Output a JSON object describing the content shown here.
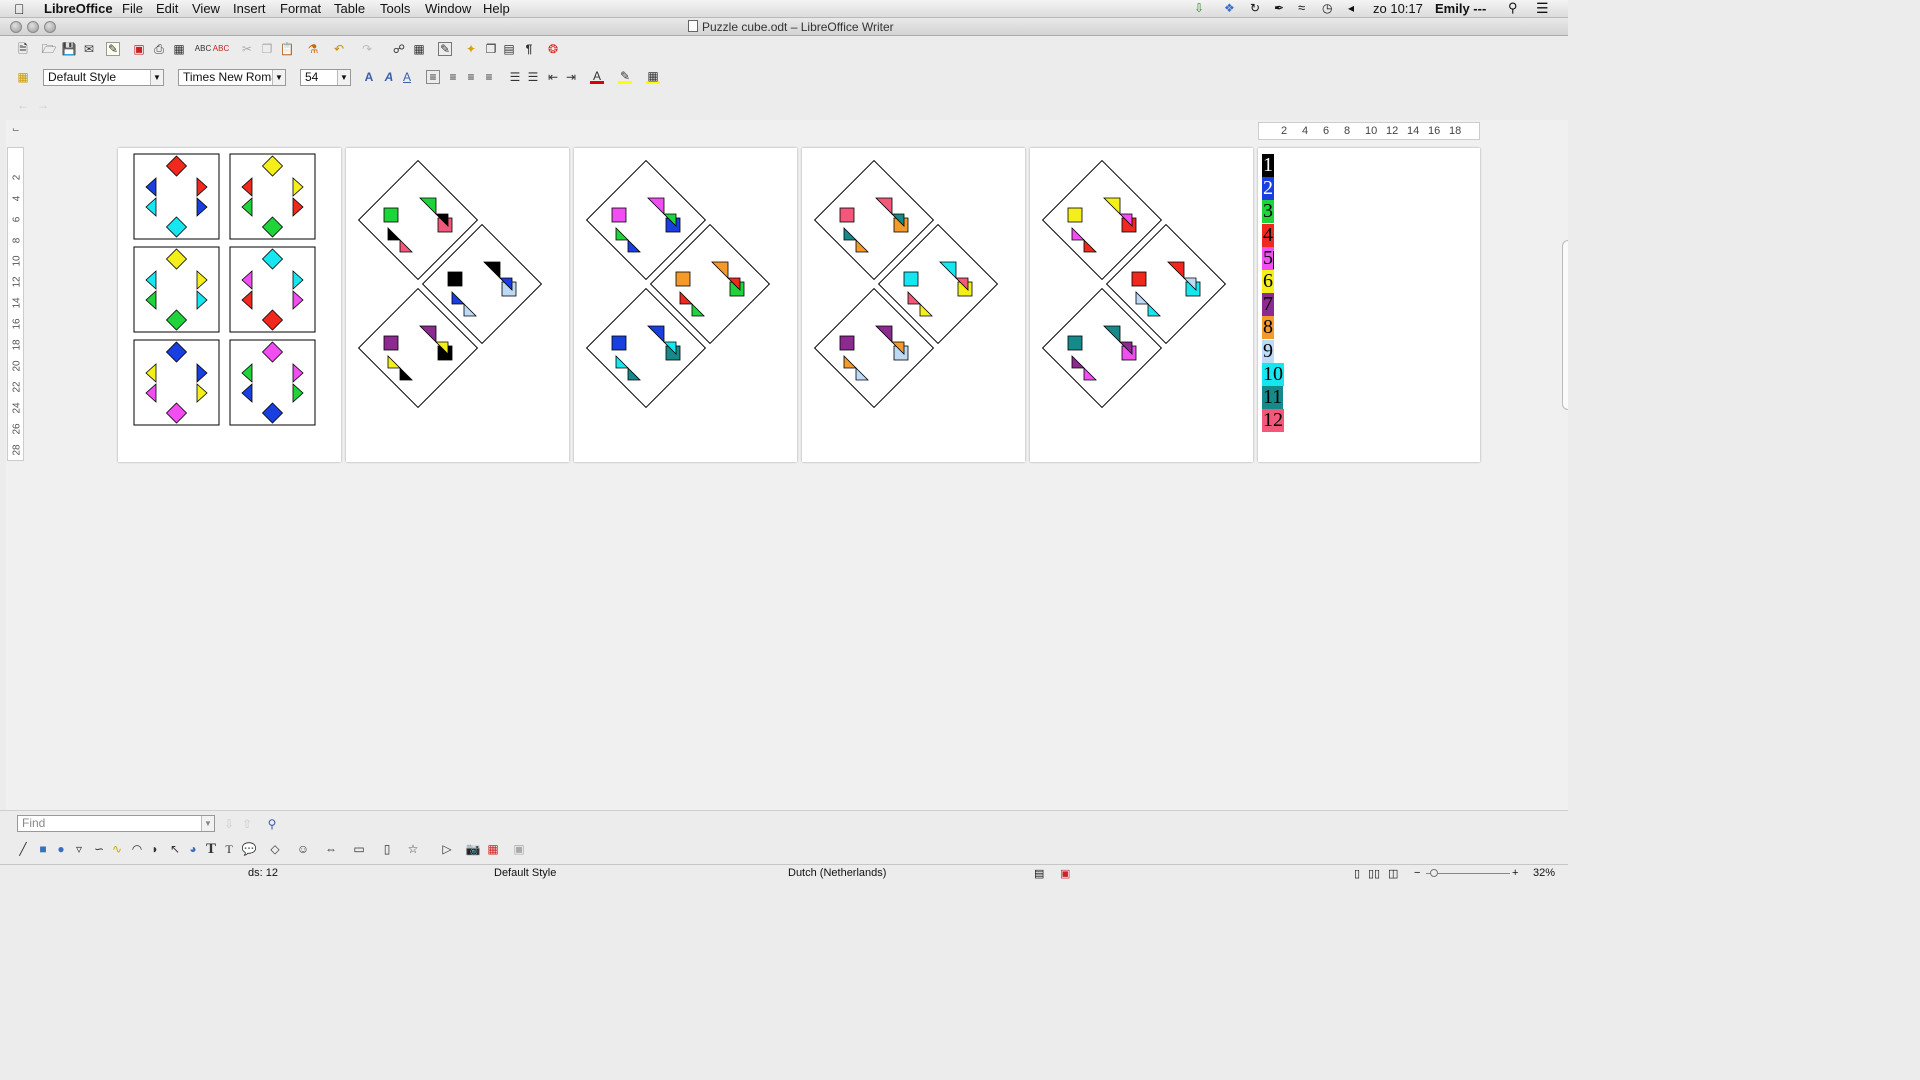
{
  "menubar": {
    "app": "LibreOffice",
    "items": [
      "File",
      "Edit",
      "View",
      "Insert",
      "Format",
      "Table",
      "Tools",
      "Window",
      "Help"
    ],
    "clock": "zo 10:17",
    "user": "Emily ---"
  },
  "titlebar": {
    "title": "Puzzle cube.odt – LibreOffice Writer"
  },
  "formatting": {
    "paragraph_style": "Default Style",
    "font_name": "Times New Roma",
    "font_size": "54"
  },
  "ruler": {
    "vertical": [
      "2",
      "4",
      "6",
      "8",
      "10",
      "12",
      "14",
      "16",
      "18",
      "20",
      "22",
      "24",
      "26",
      "28"
    ],
    "horizontal": [
      "2",
      "4",
      "6",
      "8",
      "10",
      "12",
      "14",
      "16",
      "18"
    ]
  },
  "color_list": [
    {
      "label": "1",
      "color": "#000000",
      "text": "#ffffff"
    },
    {
      "label": "2",
      "color": "#1a3fe0",
      "text": "#ffffff"
    },
    {
      "label": "3",
      "color": "#1fd43a",
      "text": "#000000"
    },
    {
      "label": "4",
      "color": "#f0281e",
      "text": "#000000"
    },
    {
      "label": "5",
      "color": "#f04ef0",
      "text": "#000000"
    },
    {
      "label": "6",
      "color": "#f4ef1a",
      "text": "#000000"
    },
    {
      "label": "7",
      "color": "#8b2a8f",
      "text": "#000000"
    },
    {
      "label": "8",
      "color": "#f39a2a",
      "text": "#000000"
    },
    {
      "label": "9",
      "color": "#bcd9f5",
      "text": "#000000"
    },
    {
      "label": "10",
      "color": "#16e6f0",
      "text": "#000000"
    },
    {
      "label": "11",
      "color": "#168a8a",
      "text": "#000000"
    },
    {
      "label": "12",
      "color": "#f2587a",
      "text": "#000000"
    }
  ],
  "cards": [
    {
      "top": "#f0281e",
      "left": "#1a3fe0",
      "right": "#f0281e",
      "bottom": "#16e6f0",
      "lefta": "#1a3fe0",
      "leftb": "#16e6f0",
      "righta": "#f0281e",
      "rightb": "#1a3fe0"
    },
    {
      "top": "#f4ef1a",
      "lefta": "#f0281e",
      "leftb": "#1fd43a",
      "righta": "#f4ef1a",
      "rightb": "#f0281e",
      "bottom": "#1fd43a"
    },
    {
      "top": "#f4ef1a",
      "lefta": "#16e6f0",
      "leftb": "#1fd43a",
      "righta": "#f4ef1a",
      "rightb": "#16e6f0",
      "bottom": "#1fd43a"
    },
    {
      "top": "#16e6f0",
      "lefta": "#f04ef0",
      "leftb": "#f0281e",
      "righta": "#16e6f0",
      "rightb": "#f04ef0",
      "bottom": "#f0281e"
    },
    {
      "top": "#1a3fe0",
      "lefta": "#f4ef1a",
      "leftb": "#f04ef0",
      "righta": "#1a3fe0",
      "rightb": "#f4ef1a",
      "bottom": "#f04ef0"
    },
    {
      "top": "#f04ef0",
      "lefta": "#1fd43a",
      "leftb": "#1a3fe0",
      "righta": "#f04ef0",
      "rightb": "#1fd43a",
      "bottom": "#1a3fe0"
    }
  ],
  "tiles": [
    [
      {
        "sq1": "#1fd43a",
        "t1a": "#1fd43a",
        "t1b": "#000000",
        "t2a": "#000000",
        "t2b": "#f2587a",
        "sq2": "#f2587a"
      },
      {
        "sq1": "#000000",
        "t1a": "#000000",
        "t1b": "#1a3fe0",
        "t2a": "#1a3fe0",
        "t2b": "#bcd9f5",
        "sq2": "#bcd9f5"
      },
      {
        "sq1": "#8b2a8f",
        "t1a": "#8b2a8f",
        "t1b": "#f4ef1a",
        "t2a": "#f4ef1a",
        "t2b": "#000000",
        "sq2": "#000000"
      }
    ],
    [
      {
        "sq1": "#f04ef0",
        "t1a": "#f04ef0",
        "t1b": "#1fd43a",
        "t2a": "#1fd43a",
        "t2b": "#1a3fe0",
        "sq2": "#1a3fe0"
      },
      {
        "sq1": "#f39a2a",
        "t1a": "#f39a2a",
        "t1b": "#f0281e",
        "t2a": "#f0281e",
        "t2b": "#1fd43a",
        "sq2": "#1fd43a"
      },
      {
        "sq1": "#1a3fe0",
        "t1a": "#1a3fe0",
        "t1b": "#16e6f0",
        "t2a": "#16e6f0",
        "t2b": "#168a8a",
        "sq2": "#168a8a"
      }
    ],
    [
      {
        "sq1": "#f2587a",
        "t1a": "#f2587a",
        "t1b": "#168a8a",
        "t2a": "#168a8a",
        "t2b": "#f39a2a",
        "sq2": "#f39a2a"
      },
      {
        "sq1": "#16e6f0",
        "t1a": "#16e6f0",
        "t1b": "#f2587a",
        "t2a": "#f2587a",
        "t2b": "#f4ef1a",
        "sq2": "#f4ef1a"
      },
      {
        "sq1": "#8b2a8f",
        "t1a": "#8b2a8f",
        "t1b": "#f39a2a",
        "t2a": "#f39a2a",
        "t2b": "#bcd9f5",
        "sq2": "#bcd9f5"
      }
    ],
    [
      {
        "sq1": "#f4ef1a",
        "t1a": "#f4ef1a",
        "t1b": "#f04ef0",
        "t2a": "#f04ef0",
        "t2b": "#f0281e",
        "sq2": "#f0281e"
      },
      {
        "sq1": "#f0281e",
        "t1a": "#f0281e",
        "t1b": "#bcd9f5",
        "t2a": "#bcd9f5",
        "t2b": "#16e6f0",
        "sq2": "#16e6f0"
      },
      {
        "sq1": "#168a8a",
        "t1a": "#168a8a",
        "t1b": "#8b2a8f",
        "t2a": "#8b2a8f",
        "t2b": "#f04ef0",
        "sq2": "#f04ef0"
      }
    ]
  ],
  "find": {
    "placeholder": "Find"
  },
  "statusbar": {
    "words": "ds: 12",
    "page_style": "Default Style",
    "language": "Dutch (Netherlands)",
    "zoom": "32%"
  }
}
